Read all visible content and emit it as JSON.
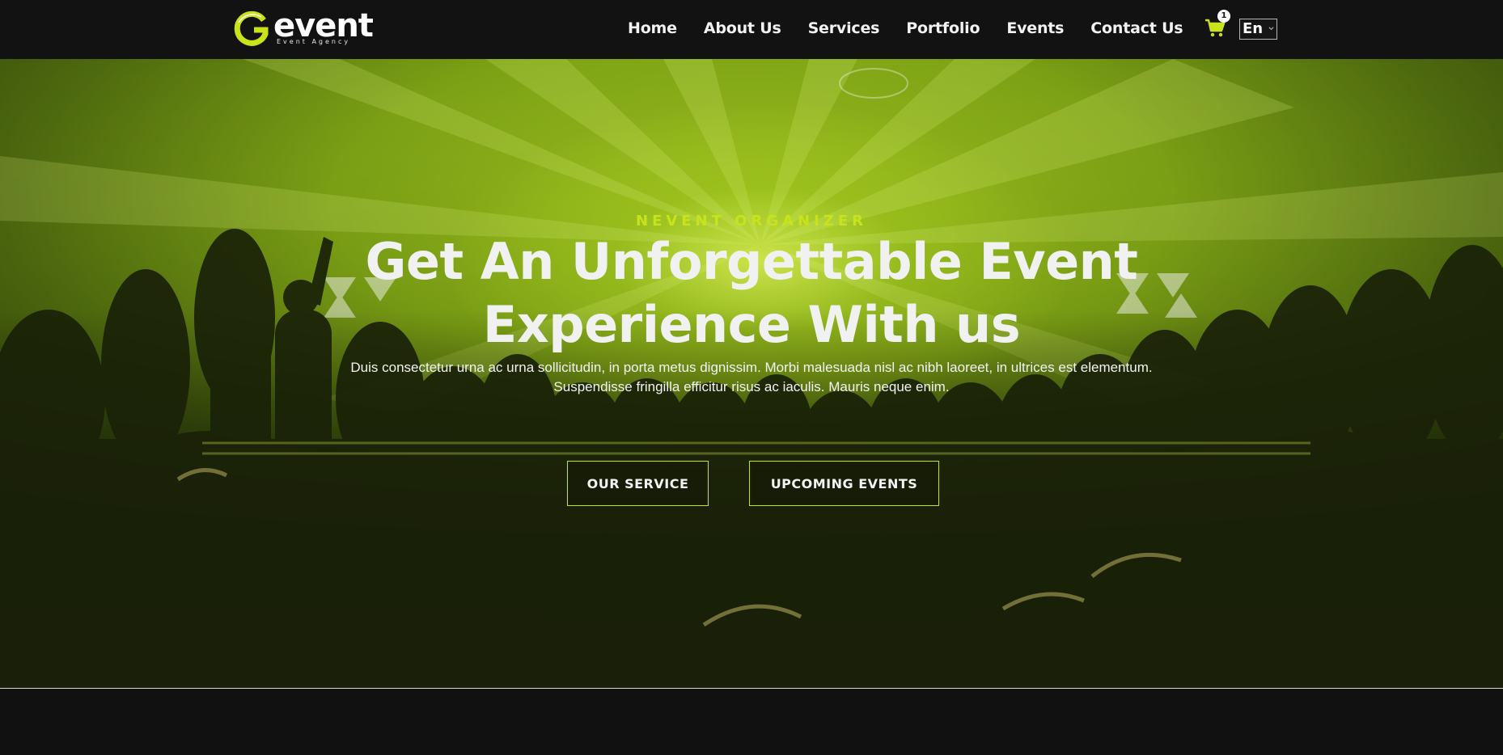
{
  "brand": {
    "logo_word": "event",
    "logo_tagline": "Event Agency",
    "accent_color": "#c9e31b"
  },
  "nav": {
    "items": [
      {
        "label": "Home"
      },
      {
        "label": "About Us"
      },
      {
        "label": "Services"
      },
      {
        "label": "Portfolio"
      },
      {
        "label": "Events"
      },
      {
        "label": "Contact Us"
      }
    ]
  },
  "cart": {
    "icon": "cart-icon",
    "count": "1"
  },
  "language": {
    "selected": "En"
  },
  "hero": {
    "eyebrow": "NEVENT ORGANIZER",
    "headline_line1": "Get An Unforgettable Event",
    "headline_line2": "Experience With us",
    "lead": "Duis consectetur urna ac urna sollicitudin, in porta metus dignissim. Morbi malesuada nisl ac nibh laoreet, in ultrices est elementum. Suspendisse fringilla efficitur risus ac iaculis. Mauris neque enim.",
    "primary_button": "OUR SERVICE",
    "secondary_button": "UPCOMING EVENTS"
  }
}
